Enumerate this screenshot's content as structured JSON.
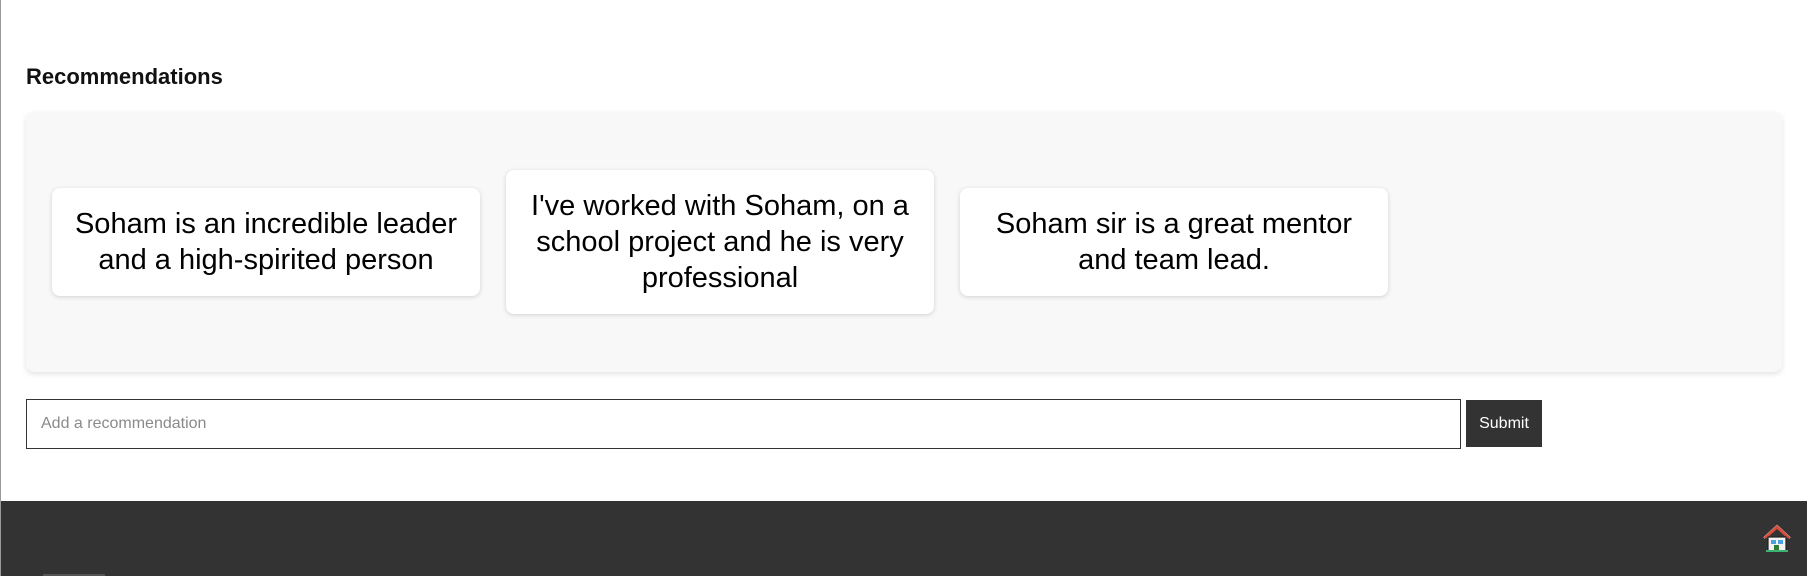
{
  "recommendations": {
    "title": "Recommendations",
    "items": [
      "Soham is an incredible leader and a high-spirited person",
      "I've worked with Soham, on a school project and he is very professional",
      "Soham sir is a great mentor and team lead."
    ]
  },
  "form": {
    "placeholder": "Add a recommendation",
    "submit_label": "Submit"
  },
  "footer": {
    "home_icon": "home-icon"
  },
  "colors": {
    "footer_bg": "#333333",
    "button_bg": "#333333",
    "card_container_bg": "#f8f8f8"
  }
}
